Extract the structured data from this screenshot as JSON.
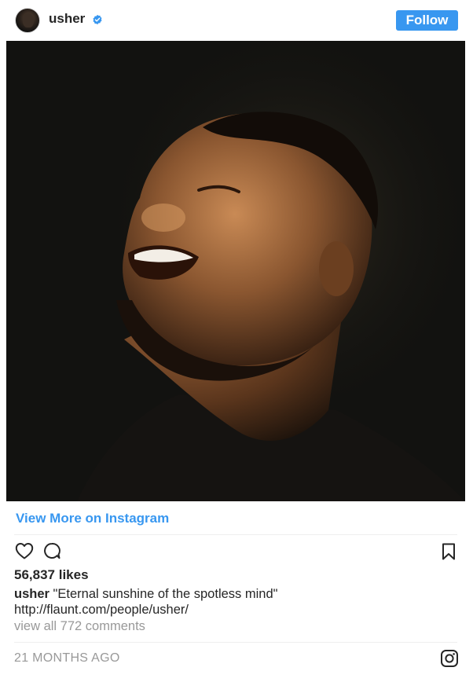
{
  "post": {
    "username": "usher",
    "verified": true,
    "follow_label": "Follow",
    "view_more_label": "View More on Instagram",
    "likes_text": "56,837 likes",
    "caption_user": "usher",
    "caption_text": "\"Eternal sunshine of the spotless mind\"",
    "caption_link": "http://flaunt.com/people/usher/",
    "view_all_comments": "view all 772 comments",
    "timestamp": "21 MONTHS AGO"
  },
  "icons": {
    "avatar": "profile-avatar",
    "verified": "verified-badge-icon",
    "like": "heart-icon",
    "comment": "comment-bubble-icon",
    "save": "bookmark-icon",
    "brand": "instagram-logo-icon"
  },
  "colors": {
    "accent": "#3897f0",
    "text": "#262626",
    "muted": "#999999",
    "divider": "#efefef"
  }
}
